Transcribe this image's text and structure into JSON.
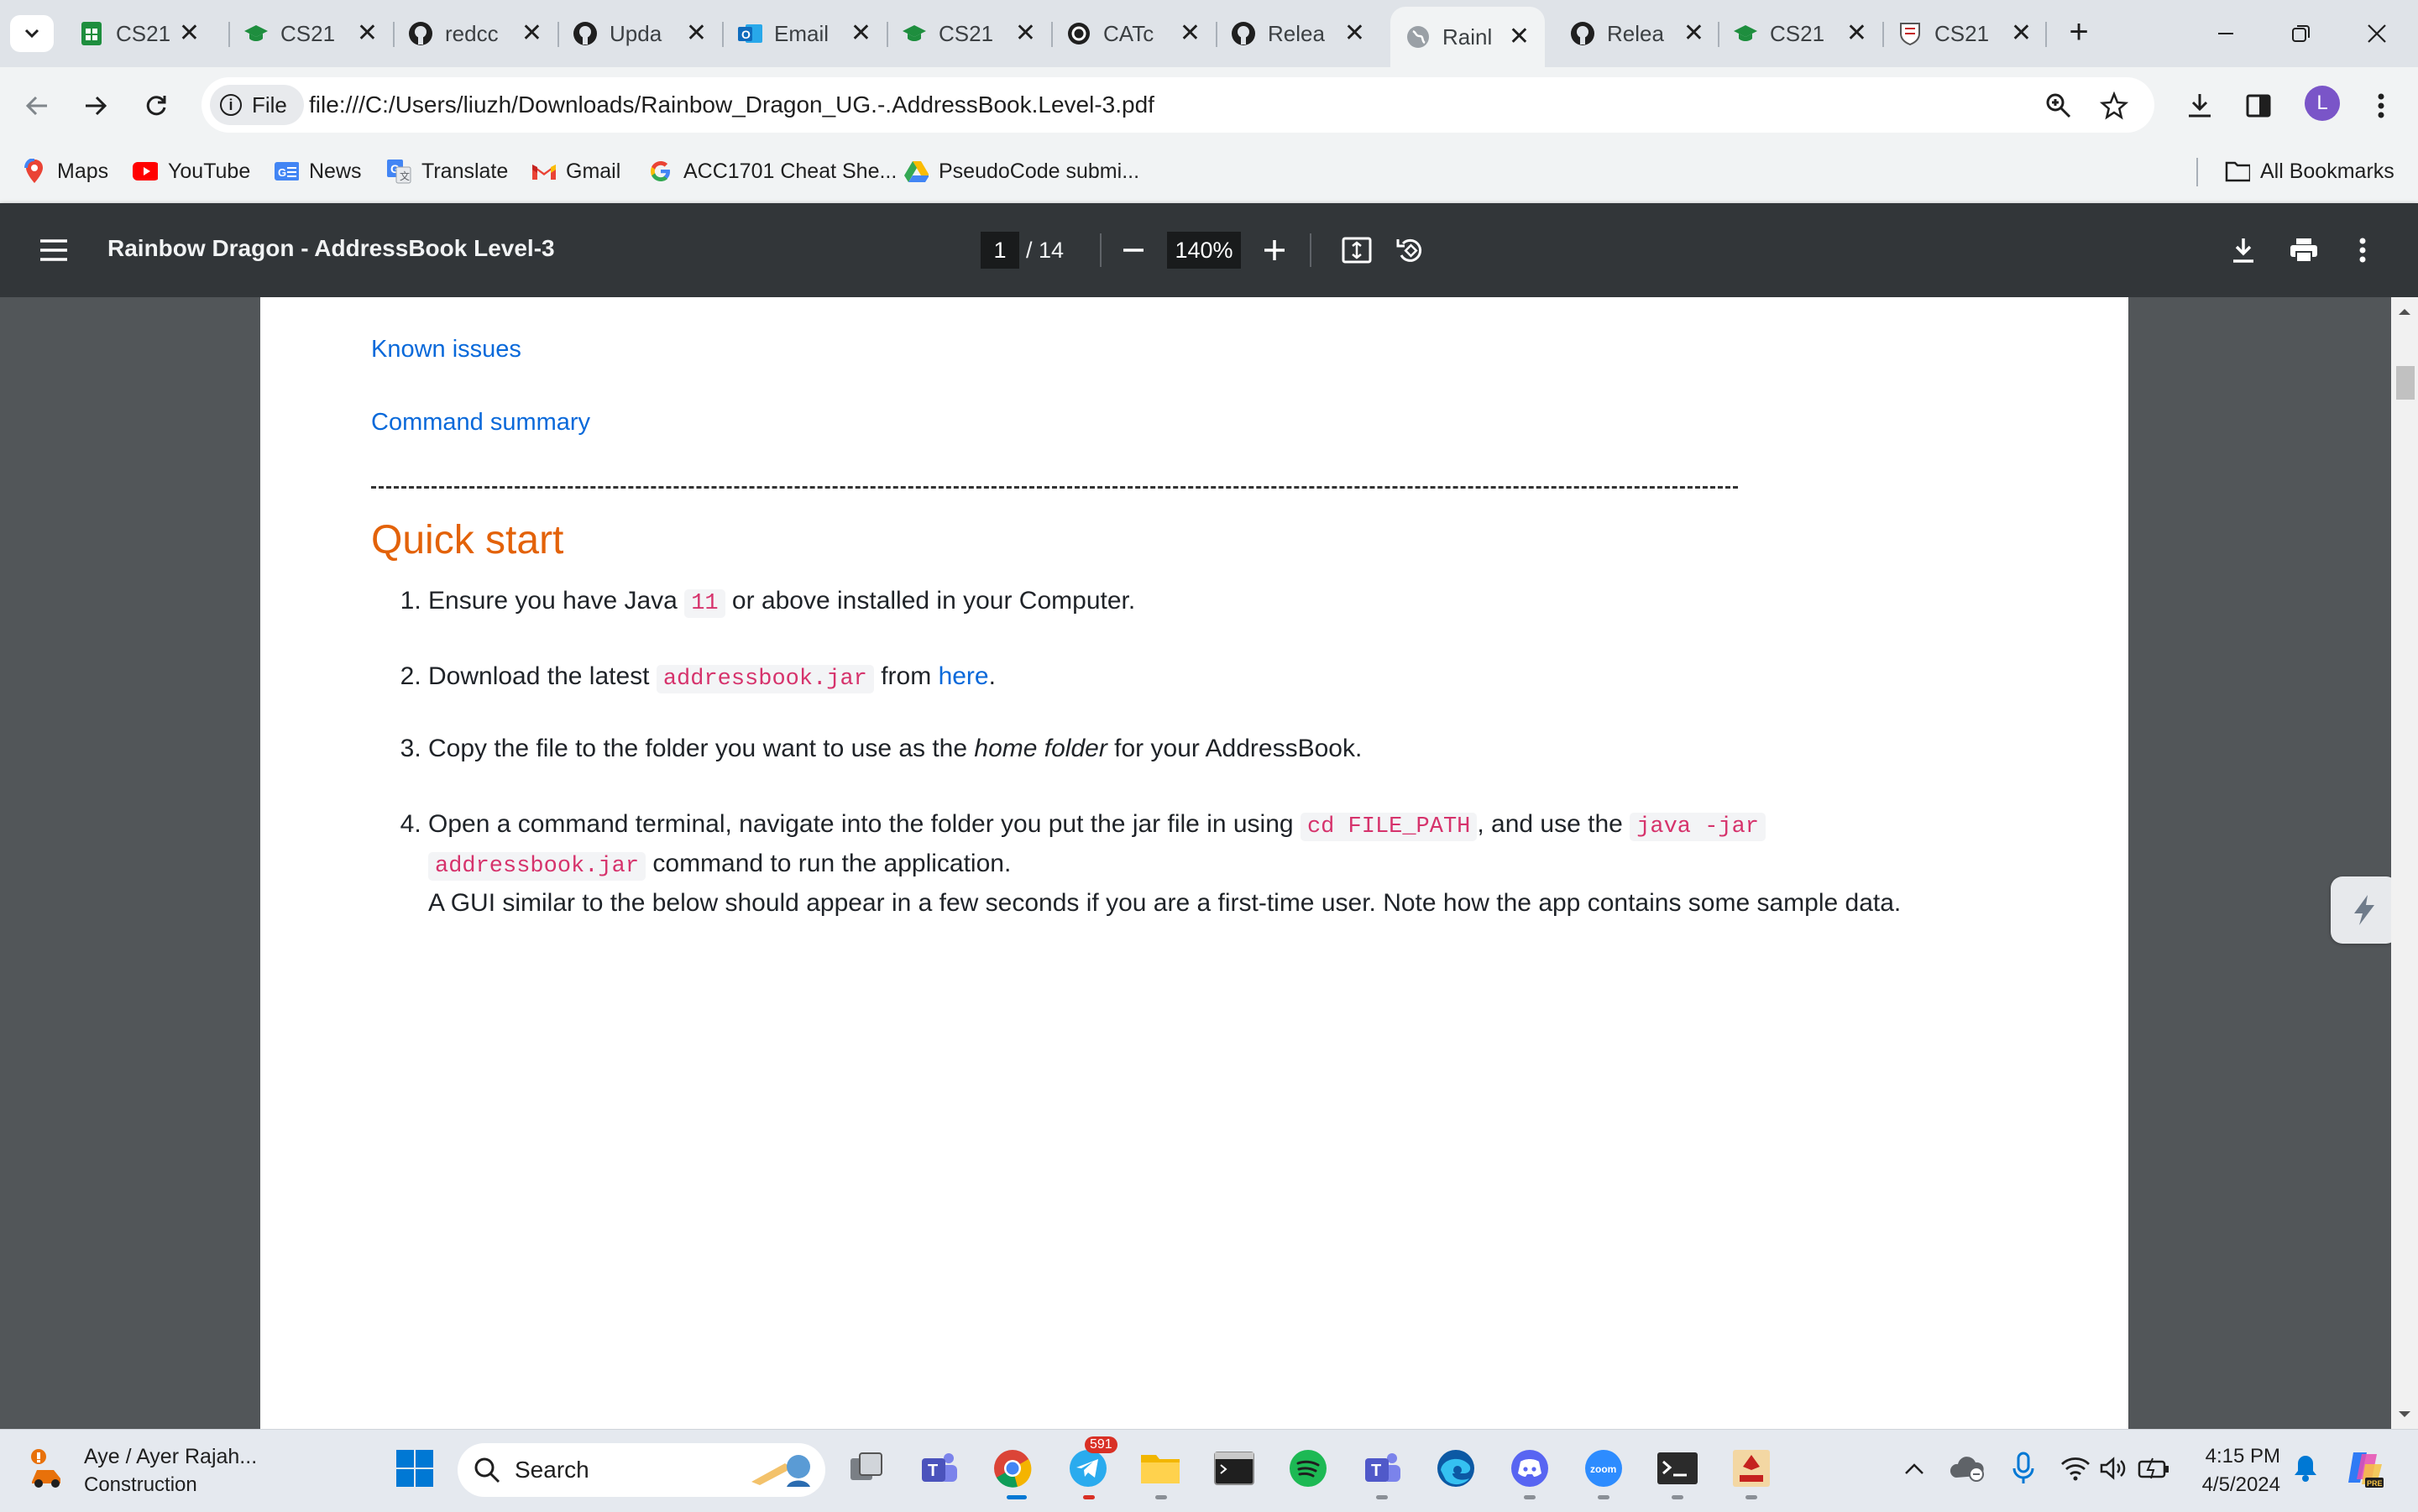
{
  "browser": {
    "tabs": [
      {
        "title": "CS21",
        "icon": "sheets-icon",
        "active": false
      },
      {
        "title": "CS21",
        "icon": "graduation-cap-icon",
        "active": false
      },
      {
        "title": "redcc",
        "icon": "github-icon",
        "active": false
      },
      {
        "title": "Upda",
        "icon": "github-icon",
        "active": false
      },
      {
        "title": "Email",
        "icon": "outlook-icon",
        "active": false
      },
      {
        "title": "CS21",
        "icon": "graduation-cap-icon",
        "active": false
      },
      {
        "title": "CATc",
        "icon": "catcode-icon",
        "active": false
      },
      {
        "title": "Relea",
        "icon": "github-icon",
        "active": false
      },
      {
        "title": "Rainl",
        "icon": "globe-icon",
        "active": true
      },
      {
        "title": "Relea",
        "icon": "github-icon",
        "active": false
      },
      {
        "title": "CS21",
        "icon": "graduation-cap-icon",
        "active": false
      },
      {
        "title": "CS21",
        "icon": "crest-icon",
        "active": false
      }
    ],
    "address": {
      "chip": "File",
      "url": "file:///C:/Users/liuzh/Downloads/Rainbow_Dragon_UG.-.AddressBook.Level-3.pdf"
    },
    "profile_initial": "L",
    "bookmarks": [
      "Maps",
      "YouTube",
      "News",
      "Translate",
      "Gmail",
      "ACC1701 Cheat She...",
      "PseudoCode submi..."
    ],
    "all_bookmarks": "All Bookmarks"
  },
  "pdf": {
    "title": "Rainbow Dragon - AddressBook Level-3",
    "page_current": "1",
    "page_total": "/ 14",
    "zoom": "140%"
  },
  "document": {
    "links": [
      "Known issues",
      "Command summary"
    ],
    "heading": "Quick start",
    "steps": {
      "s1": {
        "a": "Ensure you have Java ",
        "code": "11",
        "b": " or above installed in your Computer."
      },
      "s2": {
        "a": "Download the latest ",
        "code": "addressbook.jar",
        "b": " from ",
        "link": "here",
        "c": "."
      },
      "s3": {
        "a": "Copy the file to the folder you want to use as the ",
        "em": "home folder",
        "b": " for your AddressBook."
      },
      "s4": {
        "a": "Open a command terminal, navigate into the folder you put the jar file in using ",
        "code1": "cd FILE_PATH",
        "b": ", and use the ",
        "code2": "java -jar",
        "code3": "addressbook.jar",
        "c": " command to run the application.",
        "d": "A GUI similar to the below should appear in a few seconds if you are a first-time user. Note how the app contains some sample data."
      }
    }
  },
  "taskbar": {
    "weather_title": "Aye / Ayer Rajah...",
    "weather_sub": "Construction",
    "search": "Search",
    "telegram_badge": "591",
    "time": "4:15 PM",
    "date": "4/5/2024"
  },
  "colors": {
    "link": "#0969da",
    "heading": "#e36209",
    "code": "#d6336c",
    "pdf_toolbar": "#323639",
    "pdf_background": "#525659"
  }
}
